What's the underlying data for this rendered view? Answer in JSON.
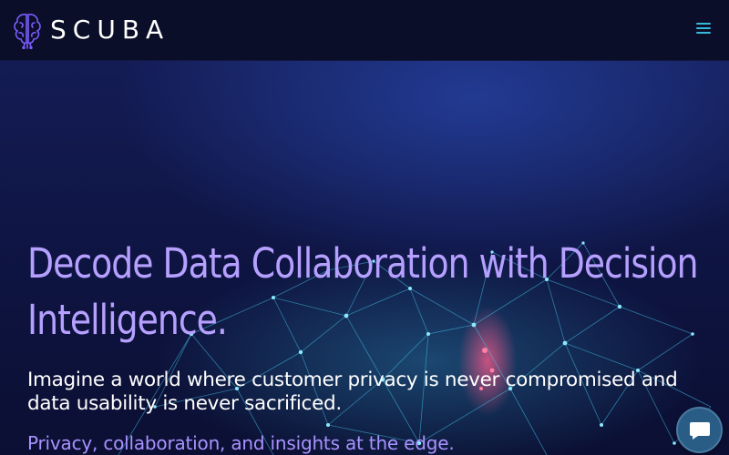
{
  "brand": {
    "name": "SCUBA",
    "logo_icon": "brain-icon",
    "logo_color": "#7a5cff"
  },
  "nav": {
    "menu_icon": "hamburger-menu-icon",
    "menu_color": "#3ab8d8"
  },
  "hero": {
    "title": "Decode Data Collaboration with Decision Intelligence.",
    "subtitle": "Imagine a world where customer privacy is never compromised and data usability is never sacrificed.",
    "tagline": "Privacy, collaboration, and insights at the edge.",
    "title_color": "#b6a0ff",
    "tagline_color": "#a992ff",
    "background_image": "data-network-visualization"
  },
  "chat": {
    "icon": "chat-bubble-icon",
    "color": "#2a5d86"
  }
}
